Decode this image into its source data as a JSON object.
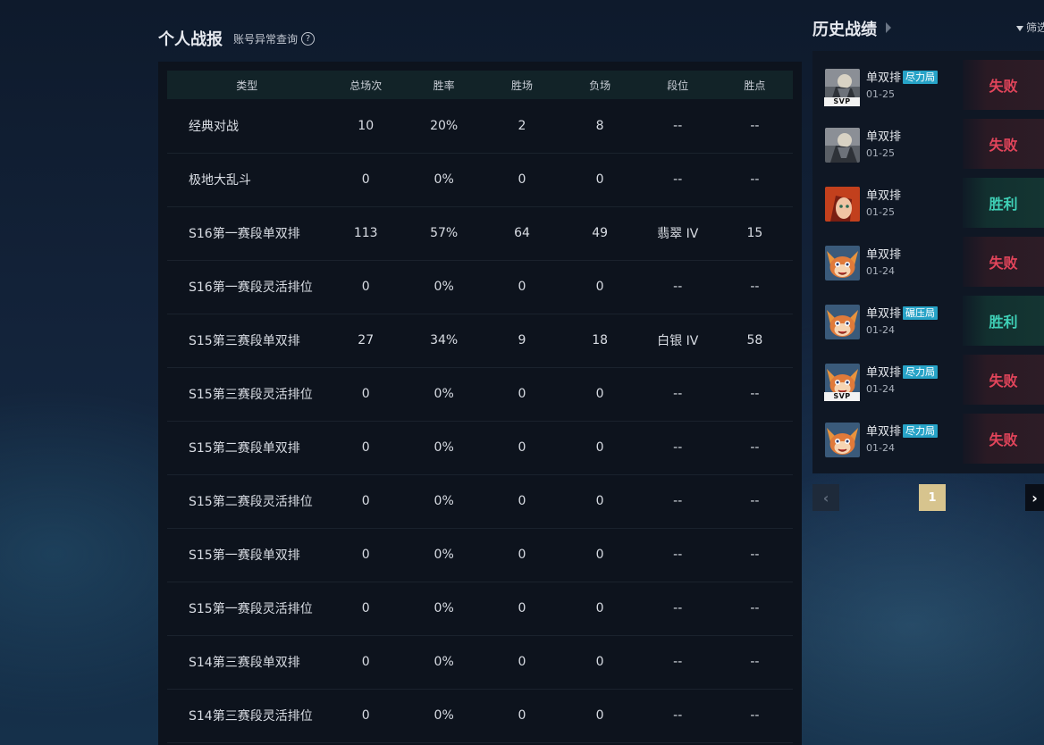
{
  "left": {
    "title": "个人战报",
    "abnormal_query": "账号异常查询",
    "help_glyph": "?",
    "columns": [
      "类型",
      "总场次",
      "胜率",
      "胜场",
      "负场",
      "段位",
      "胜点"
    ],
    "rows": [
      [
        "经典对战",
        "10",
        "20%",
        "2",
        "8",
        "--",
        "--"
      ],
      [
        "极地大乱斗",
        "0",
        "0%",
        "0",
        "0",
        "--",
        "--"
      ],
      [
        "S16第一赛段单双排",
        "113",
        "57%",
        "64",
        "49",
        "翡翠 IV",
        "15"
      ],
      [
        "S16第一赛段灵活排位",
        "0",
        "0%",
        "0",
        "0",
        "--",
        "--"
      ],
      [
        "S15第三赛段单双排",
        "27",
        "34%",
        "9",
        "18",
        "白银 IV",
        "58"
      ],
      [
        "S15第三赛段灵活排位",
        "0",
        "0%",
        "0",
        "0",
        "--",
        "--"
      ],
      [
        "S15第二赛段单双排",
        "0",
        "0%",
        "0",
        "0",
        "--",
        "--"
      ],
      [
        "S15第二赛段灵活排位",
        "0",
        "0%",
        "0",
        "0",
        "--",
        "--"
      ],
      [
        "S15第一赛段单双排",
        "0",
        "0%",
        "0",
        "0",
        "--",
        "--"
      ],
      [
        "S15第一赛段灵活排位",
        "0",
        "0%",
        "0",
        "0",
        "--",
        "--"
      ],
      [
        "S14第三赛段单双排",
        "0",
        "0%",
        "0",
        "0",
        "--",
        "--"
      ],
      [
        "S14第三赛段灵活排位",
        "0",
        "0%",
        "0",
        "0",
        "--",
        "--"
      ]
    ]
  },
  "history": {
    "title": "历史战绩",
    "filter_label": "筛选",
    "matches": [
      {
        "mode": "单双排",
        "tag": "尽力局",
        "date": "01-25",
        "result": "失败",
        "outcome": "lose",
        "svp": "SVP",
        "champ": "armored"
      },
      {
        "mode": "单双排",
        "tag": "",
        "date": "01-25",
        "result": "失败",
        "outcome": "lose",
        "svp": "",
        "champ": "armored"
      },
      {
        "mode": "单双排",
        "tag": "",
        "date": "01-25",
        "result": "胜利",
        "outcome": "win",
        "svp": "",
        "champ": "redhair"
      },
      {
        "mode": "单双排",
        "tag": "",
        "date": "01-24",
        "result": "失败",
        "outcome": "lose",
        "svp": "",
        "champ": "yordle"
      },
      {
        "mode": "单双排",
        "tag": "碾压局",
        "date": "01-24",
        "result": "胜利",
        "outcome": "win",
        "svp": "",
        "champ": "yordle"
      },
      {
        "mode": "单双排",
        "tag": "尽力局",
        "date": "01-24",
        "result": "失败",
        "outcome": "lose",
        "svp": "SVP",
        "champ": "yordle"
      },
      {
        "mode": "单双排",
        "tag": "尽力局",
        "date": "01-24",
        "result": "失败",
        "outcome": "lose",
        "svp": "",
        "champ": "yordle"
      }
    ],
    "pagination": {
      "current": "1",
      "prev_glyph": "‹",
      "next_glyph": "›"
    }
  },
  "colors": {
    "win": "#3fd1b7",
    "lose": "#e3455b",
    "tag": "#27a3c7",
    "page_active": "#d7c48e"
  }
}
